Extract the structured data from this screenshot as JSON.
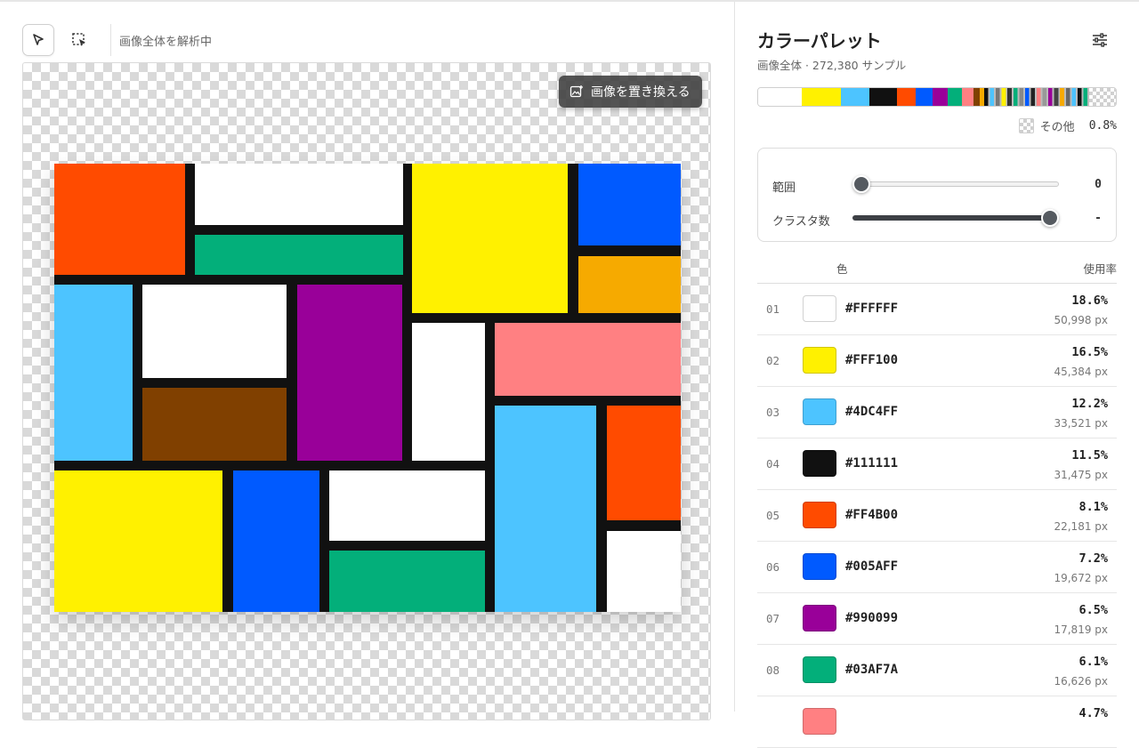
{
  "toolbar": {
    "status": "画像全体を解析中",
    "tools": [
      {
        "name": "pointer-tool",
        "icon": "cursor-arrow-icon",
        "active": true
      },
      {
        "name": "region-select-tool",
        "icon": "dashed-select-icon",
        "active": false
      }
    ]
  },
  "canvas": {
    "replace_label": "画像を置き換える",
    "replace_icon": "image-replace-icon",
    "frame_color": "#111111",
    "blocks": [
      {
        "color": "#FF4B00"
      },
      {
        "color": "#FFFFFF"
      },
      {
        "color": "#03AF7A"
      },
      {
        "color": "#FFF100"
      },
      {
        "color": "#005AFF"
      },
      {
        "color": "#F6AA00"
      },
      {
        "color": "#4DC4FF"
      },
      {
        "color": "#FFFFFF"
      },
      {
        "color": "#804000"
      },
      {
        "color": "#990099"
      },
      {
        "color": "#FFFFFF"
      },
      {
        "color": "#FF8082"
      },
      {
        "color": "#4DC4FF"
      },
      {
        "color": "#FF4B00"
      },
      {
        "color": "#FFFFFF"
      },
      {
        "color": "#FFF100"
      },
      {
        "color": "#005AFF"
      },
      {
        "color": "#FFFFFF"
      },
      {
        "color": "#03AF7A"
      }
    ]
  },
  "panel": {
    "title": "カラーパレット",
    "subtitle": "画像全体 · 272,380 サンプル",
    "settings_icon": "sliders-icon",
    "strip": [
      {
        "color": "#FFFFFF",
        "pct": 18.6
      },
      {
        "color": "#FFF100",
        "pct": 16.5
      },
      {
        "color": "#4DC4FF",
        "pct": 12.2
      },
      {
        "color": "#111111",
        "pct": 11.5
      },
      {
        "color": "#FF4B00",
        "pct": 8.1
      },
      {
        "color": "#005AFF",
        "pct": 7.2
      },
      {
        "color": "#990099",
        "pct": 6.5
      },
      {
        "color": "#03AF7A",
        "pct": 6.1
      },
      {
        "color": "#FF8082",
        "pct": 4.7
      },
      {
        "color": "#804000",
        "pct": 2.6
      },
      {
        "color": "#F6AA00",
        "pct": 2.0
      }
    ],
    "other": {
      "label": "その他",
      "value": "0.8%",
      "icon": "transparency-icon"
    },
    "controls": {
      "range": {
        "label": "範囲",
        "value": "0",
        "level": 0.0
      },
      "clusters": {
        "label": "クラスタ数",
        "value": "-",
        "level": 1.0
      }
    },
    "table": {
      "col_color": "色",
      "col_usage": "使用率",
      "rows": [
        {
          "idx": "01",
          "hex": "#FFFFFF",
          "pct": "18.6%",
          "px": "50,998 px"
        },
        {
          "idx": "02",
          "hex": "#FFF100",
          "pct": "16.5%",
          "px": "45,384 px"
        },
        {
          "idx": "03",
          "hex": "#4DC4FF",
          "pct": "12.2%",
          "px": "33,521 px"
        },
        {
          "idx": "04",
          "hex": "#111111",
          "pct": "11.5%",
          "px": "31,475 px"
        },
        {
          "idx": "05",
          "hex": "#FF4B00",
          "pct": "8.1%",
          "px": "22,181 px"
        },
        {
          "idx": "06",
          "hex": "#005AFF",
          "pct": "7.2%",
          "px": "19,672 px"
        },
        {
          "idx": "07",
          "hex": "#990099",
          "pct": "6.5%",
          "px": "17,819 px"
        },
        {
          "idx": "08",
          "hex": "#03AF7A",
          "pct": "6.1%",
          "px": "16,626 px"
        },
        {
          "idx": "",
          "hex": "",
          "pct": "4.7%",
          "px": "",
          "swatch": "#FF8082"
        }
      ]
    }
  }
}
